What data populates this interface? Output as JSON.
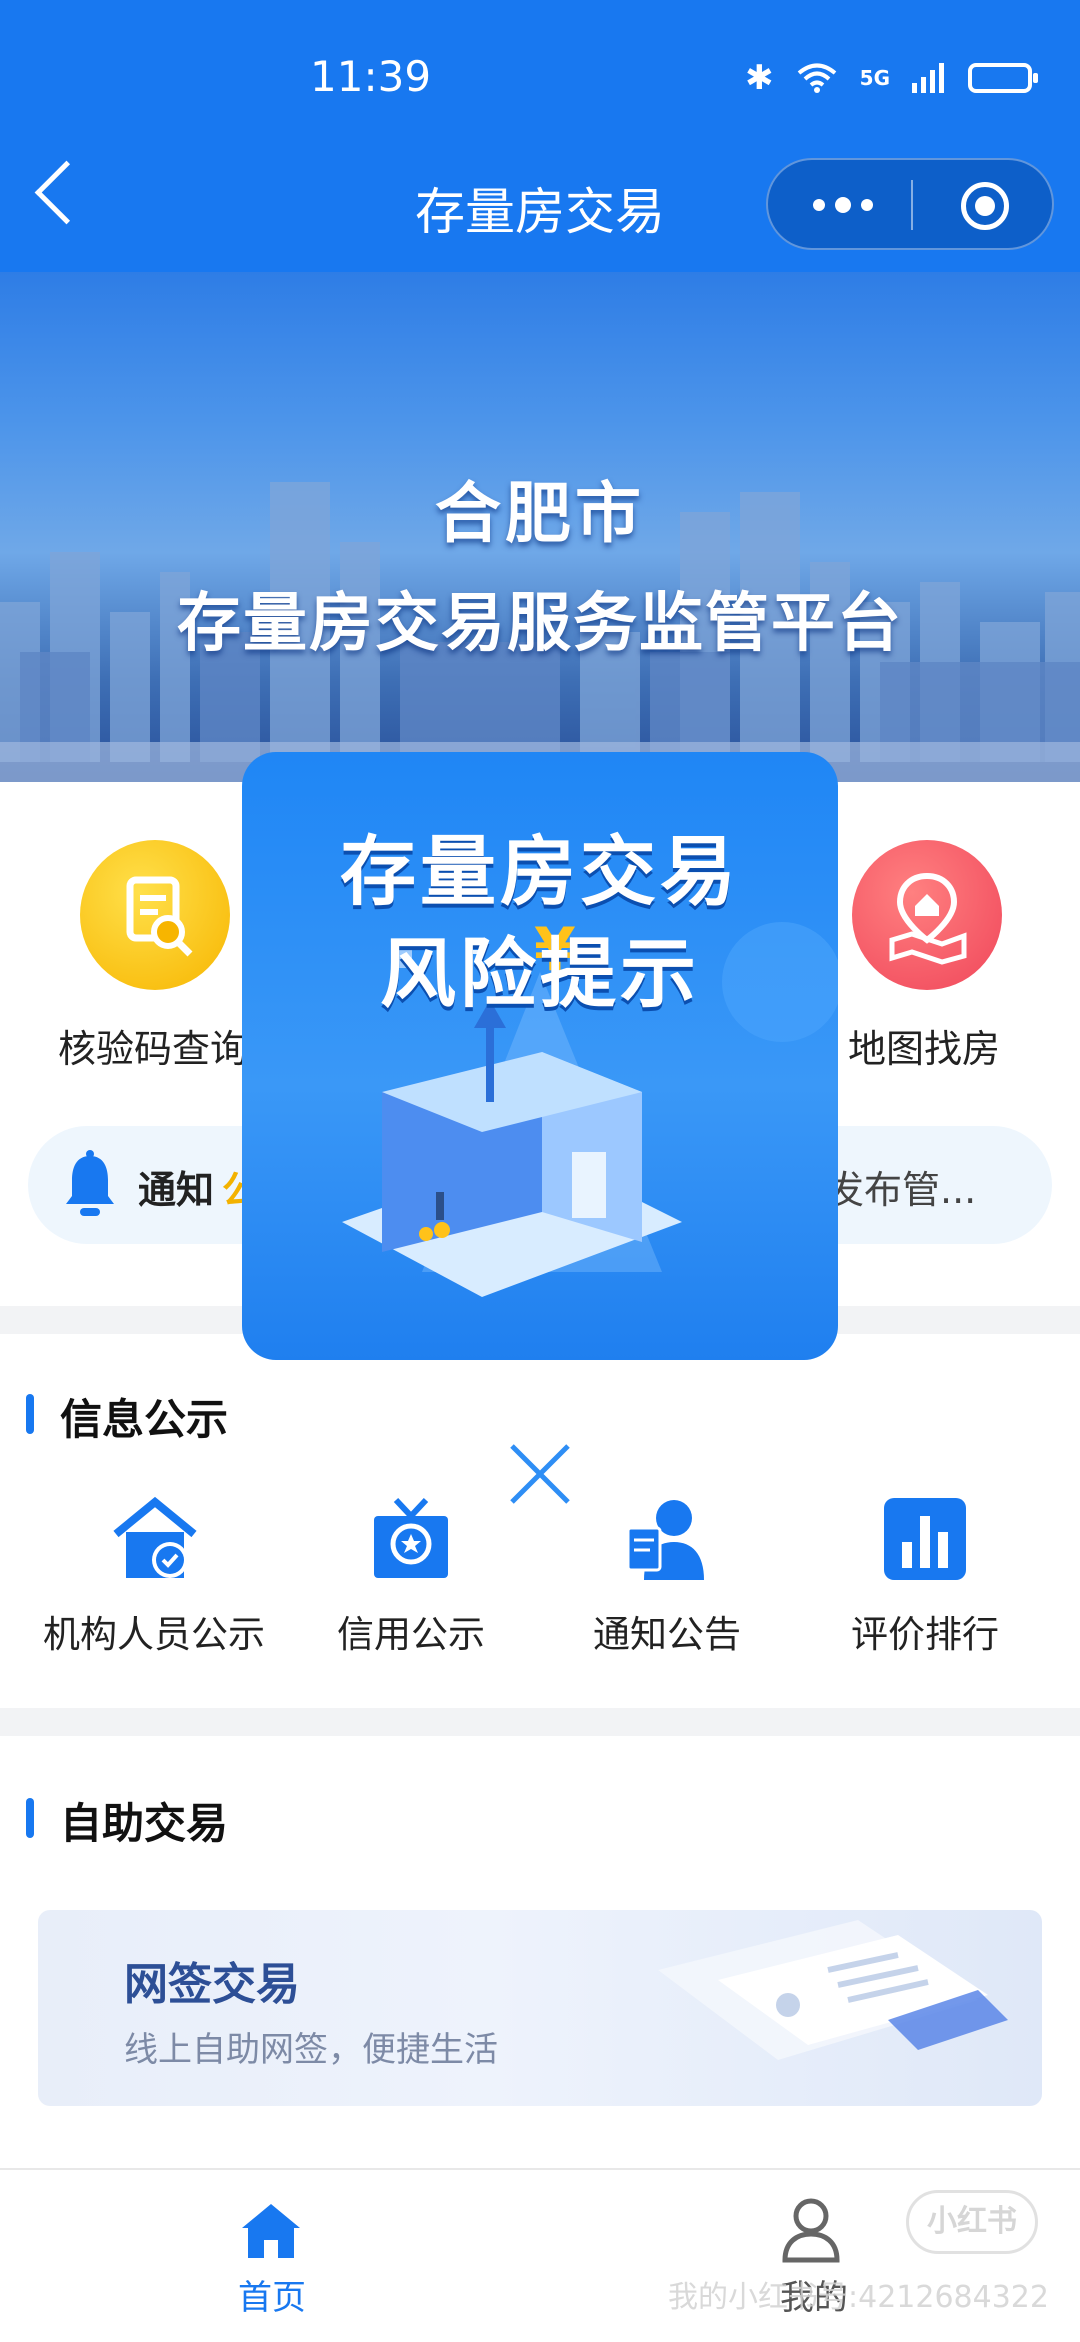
{
  "status_bar": {
    "time": "11:39",
    "signal": "5G"
  },
  "nav": {
    "title": "存量房交易"
  },
  "banner": {
    "city": "合肥市",
    "title": "存量房交易服务监管平台"
  },
  "quick_entries": [
    {
      "label": "核验码查询",
      "icon": "search-document-icon"
    },
    {
      "label": "地图找房",
      "icon": "map-house-icon"
    }
  ],
  "notice": {
    "label": "通知",
    "label_accent": "公",
    "text": "发布管..."
  },
  "info_section": {
    "title": "信息公示",
    "items": [
      {
        "label": "机构人员公示",
        "icon": "agency-house-icon"
      },
      {
        "label": "信用公示",
        "icon": "credit-badge-icon"
      },
      {
        "label": "通知公告",
        "icon": "announcer-icon"
      },
      {
        "label": "评价排行",
        "icon": "bar-chart-icon"
      }
    ]
  },
  "self_service": {
    "title": "自助交易",
    "card": {
      "title": "网签交易",
      "subtitle": "线上自助网签，便捷生活"
    }
  },
  "tabbar": {
    "home": "首页",
    "me": "我的"
  },
  "popup": {
    "line1": "存量房交易",
    "line2": "风险提示"
  },
  "watermark": {
    "badge": "小红书",
    "text": "我的小红书号:4212684322"
  },
  "colors": {
    "primary": "#1878f0",
    "accent": "#f3b200"
  }
}
